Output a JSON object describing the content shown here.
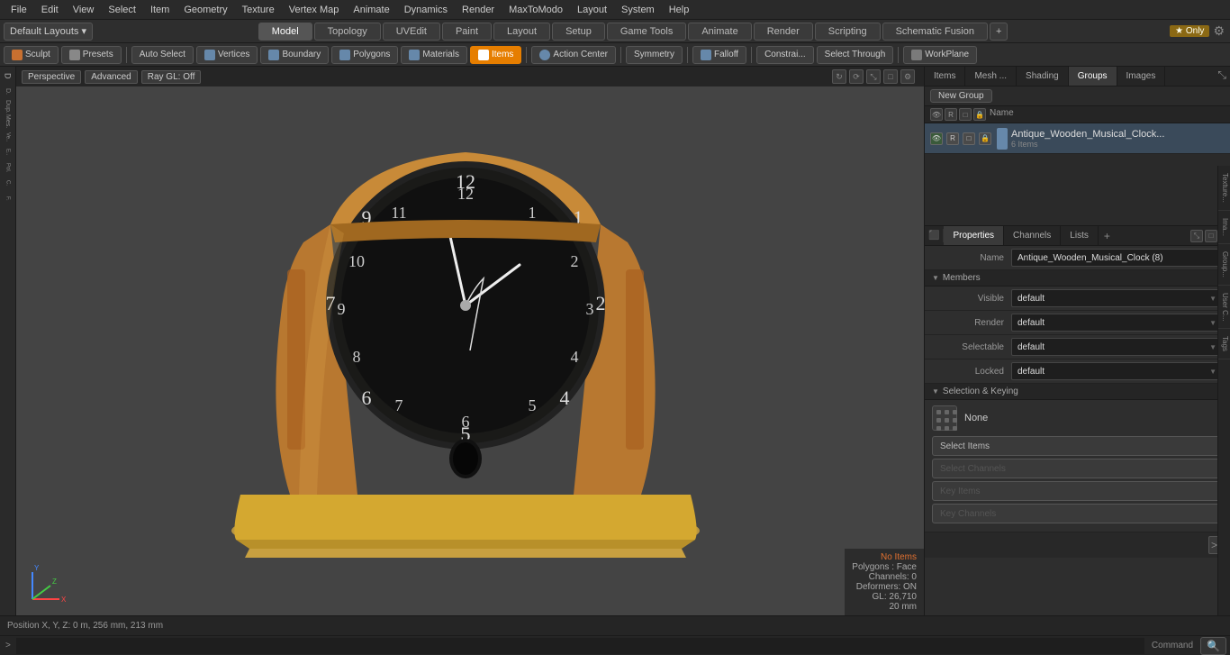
{
  "menu": {
    "items": [
      "File",
      "Edit",
      "View",
      "Select",
      "Item",
      "Geometry",
      "Texture",
      "Vertex Map",
      "Animate",
      "Dynamics",
      "Render",
      "MaxToModo",
      "Layout",
      "System",
      "Help"
    ]
  },
  "layout_bar": {
    "dropdown_label": "Default Layouts ▾",
    "tabs": [
      "Model",
      "Topology",
      "UVEdit",
      "Paint",
      "Layout",
      "Setup",
      "Game Tools",
      "Animate",
      "Render",
      "Scripting",
      "Schematic Fusion"
    ],
    "active_tab": "Model",
    "add_tab_icon": "+",
    "star_badge": "★ Only",
    "settings_icon": "⚙"
  },
  "toolbar": {
    "sculpt_label": "Sculpt",
    "presets_label": "Presets",
    "autoselect_label": "Auto Select",
    "vertices_label": "Vertices",
    "boundary_label": "Boundary",
    "polygons_label": "Polygons",
    "materials_label": "Materials",
    "items_label": "Items",
    "action_center_label": "Action Center",
    "symmetry_label": "Symmetry",
    "falloff_label": "Falloff",
    "constraints_label": "Constrai...",
    "select_through_label": "Select Through",
    "workplane_label": "WorkPlane"
  },
  "viewport": {
    "mode_label": "Perspective",
    "advanced_label": "Advanced",
    "render_label": "Ray GL: Off",
    "status": {
      "no_items": "No Items",
      "polygons": "Polygons : Face",
      "channels": "Channels: 0",
      "deformers": "Deformers: ON",
      "gl": "GL: 26,710",
      "size": "20 mm"
    },
    "position": "Position X, Y, Z:  0 m, 256 mm, 213 mm"
  },
  "right_panel": {
    "tabs": [
      "Items",
      "Mesh ...",
      "Shading",
      "Groups",
      "Images"
    ],
    "active_tab": "Groups",
    "new_group_btn": "New Group",
    "col_name": "Name",
    "group": {
      "name": "Antique_Wooden_Musical_Clock...",
      "sub": "6 Items"
    },
    "props": {
      "tabs": [
        "Properties",
        "Channels",
        "Lists"
      ],
      "active_tab": "Properties",
      "name_label": "Name",
      "name_value": "Antique_Wooden_Musical_Clock (8)",
      "members_section": "Members",
      "visible_label": "Visible",
      "visible_value": "default",
      "render_label": "Render",
      "render_value": "default",
      "selectable_label": "Selectable",
      "selectable_value": "default",
      "locked_label": "Locked",
      "locked_value": "default",
      "selection_keying_section": "Selection & Keying",
      "keying_icon_label": "None",
      "select_items_btn": "Select Items",
      "select_channels_btn": "Select Channels",
      "key_items_btn": "Key Items",
      "key_channels_btn": "Key Channels"
    }
  },
  "side_sub_tabs": [
    "Texture...",
    "Ima...",
    "Group...",
    "User C...",
    "Tags"
  ],
  "command": {
    "label": "Command",
    "expand_label": ">",
    "search_icon": "🔍"
  },
  "status_bar": {
    "position": "Position X, Y, Z:  0 m, 256 mm, 213 mm"
  }
}
